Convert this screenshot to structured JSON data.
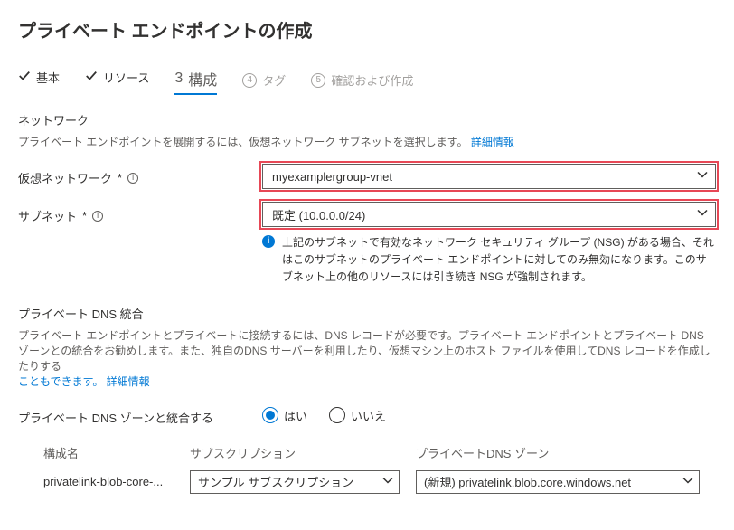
{
  "page_title": "プライベート エンドポイントの作成",
  "tabs": {
    "basics": "基本",
    "resource": "リソース",
    "config_num": "3",
    "config": "構成",
    "tags_num": "4",
    "tags": "タグ",
    "review_num": "5",
    "review": "確認および作成"
  },
  "network": {
    "title": "ネットワーク",
    "desc": "プライベート エンドポイントを展開するには、仮想ネットワーク サブネットを選択します。",
    "more": "詳細情報",
    "vnet_label": "仮想ネットワーク",
    "vnet_value": "myexamplergroup-vnet",
    "subnet_label": "サブネット",
    "subnet_value": "既定 (10.0.0.0/24)",
    "note": "上記のサブネットで有効なネットワーク セキュリティ グループ (NSG) がある場合、それはこのサブネットのプライベート エンドポイントに対してのみ無効になります。このサブネット上の他のリソースには引き続き NSG が強制されます。"
  },
  "dns": {
    "title": "プライベート DNS 統合",
    "desc1": "プライベート エンドポイントとプライベートに接続するには、DNS レコードが必要です。プライベート エンドポイントとプライベート DNS ゾーンとの統合をお勧めします。また、独自のDNS サーバーを利用したり、仮想マシン上のホスト ファイルを使用してDNS レコードを作成したりする",
    "desc2": "こともできます。",
    "more": "詳細情報",
    "integrate_label": "プライベート DNS ゾーンと統合する",
    "yes": "はい",
    "no": "いいえ",
    "cols": {
      "name": "構成名",
      "sub": "サブスクリプション",
      "zone": "プライベートDNS ゾーン"
    },
    "row": {
      "name": "privatelink-blob-core-...",
      "sub": "サンプル サブスクリプション",
      "zone": "(新規) privatelink.blob.core.windows.net"
    }
  }
}
